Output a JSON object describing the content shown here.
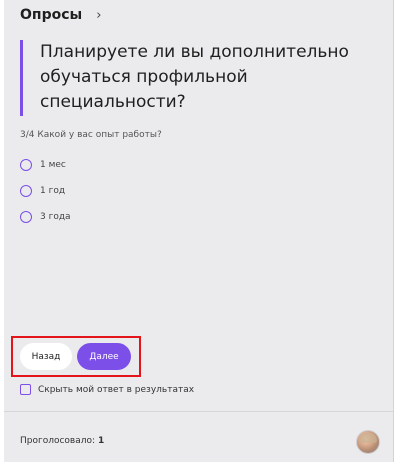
{
  "header": {
    "title": "Опросы",
    "chevron_icon": "chevron-right-icon"
  },
  "question": {
    "text": "Планируете ли вы дополнительно обучаться профильной специальности?",
    "accent_color": "#7b4fe8"
  },
  "subquestion": {
    "text": "3/4 Какой у вас опыт работы?"
  },
  "options": [
    {
      "label": "1 мес",
      "selected": false
    },
    {
      "label": "1 год",
      "selected": false
    },
    {
      "label": "3 года",
      "selected": false
    }
  ],
  "buttons": {
    "back_label": "Назад",
    "next_label": "Далее",
    "next_color": "#7b4fe8"
  },
  "hide_answer": {
    "label": "Скрыть мой ответ в результатах",
    "checked": false
  },
  "footer": {
    "voted_label": "Проголосовало:",
    "voted_count": "1"
  },
  "highlight": {
    "color": "#e4141b"
  }
}
